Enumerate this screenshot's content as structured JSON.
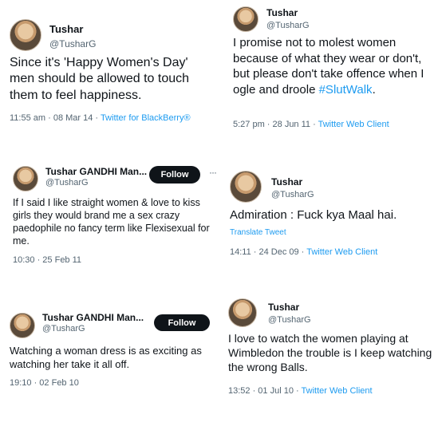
{
  "tweets": [
    {
      "name": "Tushar",
      "handle": "@TusharG",
      "text": "Since it's 'Happy Women's Day' men should be allowed to touch them to feel happiness.",
      "timestamp": "11:55 am · 08 Mar 14 · ",
      "client": "Twitter for BlackBerry®"
    },
    {
      "name": "Tushar",
      "handle": "@TusharG",
      "text": "I promise not to molest women because of what they wear or don't, but please don't take offence when I ogle and droole ",
      "hashtag": "#SlutWalk",
      "text_end": ".",
      "timestamp": "5:27 pm · 28 Jun 11 · ",
      "client": "Twitter Web Client"
    },
    {
      "name": "Tushar GANDHI Man...",
      "handle": "@TusharG",
      "follow_label": "Follow",
      "text": "If I said I like straight women & love to kiss girls they would brand me a sex crazy paedophile no fancy term like Flexisexual for me.",
      "timestamp": "10:30 · 25 Feb 11"
    },
    {
      "name": "Tushar",
      "handle": "@TusharG",
      "text": "Admiration : Fuck kya Maal hai.",
      "translate_label": "Translate Tweet",
      "timestamp": "14:11 · 24 Dec 09 · ",
      "client": "Twitter Web Client"
    },
    {
      "name": "Tushar GANDHI Man...",
      "handle": "@TusharG",
      "follow_label": "Follow",
      "text": "Watching a woman dress is as exciting as watching her take it all off.",
      "timestamp": "19:10 · 02 Feb 10"
    },
    {
      "name": "Tushar",
      "handle": "@TusharG",
      "text": "I love to watch the women playing at Wimbledon the trouble is I keep watching the wrong Balls.",
      "timestamp": "13:52 · 01 Jul 10 · ",
      "client": "Twitter Web Client"
    }
  ]
}
